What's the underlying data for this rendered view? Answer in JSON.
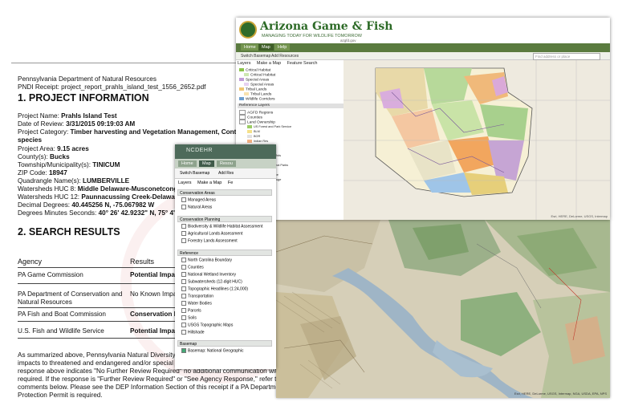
{
  "document": {
    "agency_header": "Pennsylvania Department of Natural Resources",
    "receipt": "PNDI Receipt: project_report_prahls_island_test_1556_2652.pdf",
    "section1_title": "1. PROJECT INFORMATION",
    "project_name_label": "Project Name:",
    "project_name": "Prahls Island Test",
    "date_label": "Date of Review:",
    "date": "3/31/2015 09:19:03 AM",
    "category_label": "Project Category:",
    "category": "Timber harvesting and Vegetation Management, Contro",
    "category_cont": "species",
    "area_label": "Project Area:",
    "area": "9.15 acres",
    "county_label": "County(s):",
    "county": "Bucks",
    "township_label": "Township/Municipality(s):",
    "township": "TINICUM",
    "zip_label": "ZIP Code:",
    "zip": "18947",
    "quad_label": "Quadrangle Name(s):",
    "quad": "LUMBERVILLE",
    "huc8_label": "Watersheds HUC 8:",
    "huc8": "Middle Delaware-Musconetcong",
    "huc12_label": "Watersheds HUC 12:",
    "huc12": "Paunnacussing Creek-Delawar",
    "dd_label": "Decimal Degrees:",
    "dd": "40.445256 N, -75.067982 W",
    "dms_label": "Degrees Minutes Seconds:",
    "dms": "40° 26' 42.9232\" N, 75° 4' -",
    "section2_title": "2. SEARCH RESULTS",
    "col_agency": "Agency",
    "col_results": "Results",
    "rows": [
      {
        "agency": "PA Game Commission",
        "result": "Potential Impa"
      },
      {
        "agency": "PA Department of Conservation and",
        "agency2": "Natural Resources",
        "result": "No Known Impa"
      },
      {
        "agency": "PA Fish and Boat Commission",
        "result": "Conservation I"
      },
      {
        "agency": "U.S. Fish and Wildlife Service",
        "result": "Potential Impa"
      }
    ],
    "para_l1": "As summarized above, Pennsylvania Natural Diversity I",
    "para_l2": "impacts to threatened and endangered and/or special c",
    "para_l3": "response above indicates \"No Further Review Required\" no additional communication with the respective agency is",
    "para_l4": "required. If the response is \"Further Review Required\" or \"See Agency Response,\" refer to the appropriate agency",
    "para_l5": "comments below. Please see the DEP Information Section of this receipt if a PA Department of Environmental",
    "para_l6": "Protection Permit is required."
  },
  "az_window": {
    "title": "Arizona Game & Fish",
    "tagline": "MANAGING TODAY FOR WILDLIFE TOMORROW",
    "site": "azgfd.gov",
    "nav": [
      "Home",
      "Map",
      "Help"
    ],
    "toolbar_switch": "Switch Basemap",
    "toolbar_add": "Add Resources",
    "search_placeholder": "Find address or place",
    "tabs": [
      "Layers",
      "Make a Map",
      "Feature Search"
    ],
    "layers": [
      "Critical Habitat",
      "Critical Habitat",
      "Special Areas",
      "Special Areas",
      "Tribal Lands",
      "Tribal Lands",
      "Wildlife Corridors"
    ],
    "reference_section": "Reference Layers",
    "ref_layers": [
      "AGFD Regions",
      "Counties",
      "Land Ownership"
    ],
    "legend_items": [
      "US Forest and Park Service",
      "BLM",
      "BOR",
      "Indian Res",
      "Military",
      "Private",
      "National Parks/Mnts",
      "Private",
      "State and Regional Parks",
      "State Trust",
      "US Forest Service",
      "Wildlife Area/Refuge"
    ],
    "more_layers": [
      "Milepost",
      "Quadrangles",
      "Townships"
    ],
    "attribution": "Esri, HERE, DeLorme, USGS, Intermap"
  },
  "nc_window": {
    "brand": "NCDEHR",
    "nav": [
      "Home",
      "Map",
      "Resou"
    ],
    "toolbar_switch": "Switch Basemap",
    "toolbar_add": "Add Res",
    "tabs": [
      "Layers",
      "Make a Map",
      "Fe"
    ],
    "sec_conservation": "Conservation Areas",
    "conservation": [
      "Managed Areas",
      "Natural Areas"
    ],
    "sec_planning": "Conservation Planning",
    "planning": [
      "Biodiversity & Wildlife Habitat Assessment",
      "Agricultural Lands Assessment",
      "Forestry Lands Assessment"
    ],
    "sec_reference": "Reference",
    "reference": [
      "North Carolina Boundary",
      "Counties",
      "National Wetland Inventory",
      "Subwatersheds (12-digit HUC)",
      "Topographic Headlines (1:24,000)",
      "Transportation",
      "Water Bodies",
      "Parcels",
      "Soils",
      "USGS Topographic Maps",
      "Hillshade"
    ],
    "sec_basemap": "Basemap",
    "basemap": "Basemap: National Geographic"
  },
  "nc_map": {
    "attribution": "Esri, HERE, DeLorme, USGS, Intermap, NGA, USDA, EPA, NPS"
  }
}
